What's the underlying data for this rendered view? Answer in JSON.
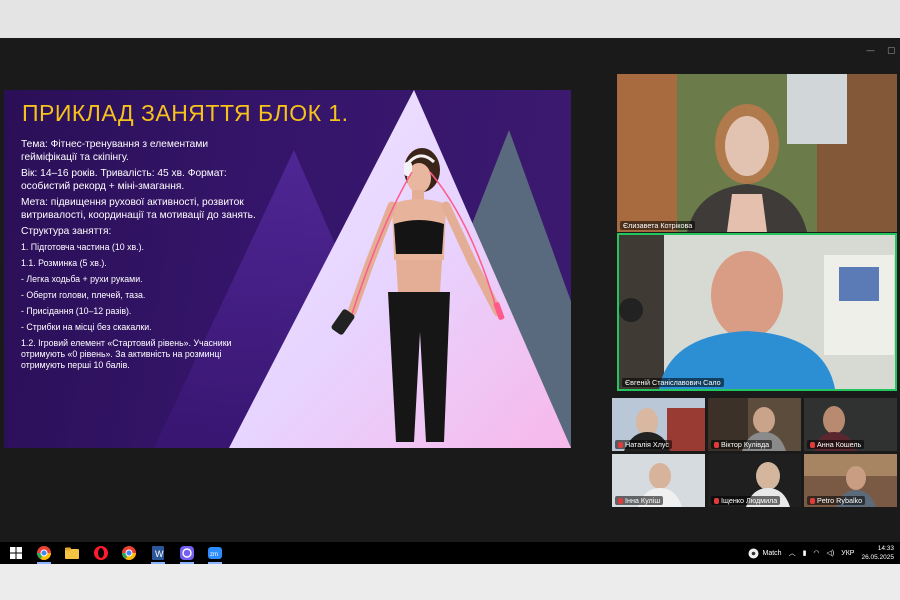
{
  "slide": {
    "title": "ПРИКЛАД ЗАНЯТТЯ БЛОК 1.",
    "paragraphs": [
      "Тема: Фітнес-тренування з елементами гейміфікації та скіпінгу.",
      "Вік: 14–16 років. Тривалість: 45 хв. Формат: особистий рекорд + міні-змагання.",
      "Мета: підвищення рухової активності, розвиток витривалості, координації та мотивації до занять.",
      "Структура заняття:"
    ],
    "items": [
      "1. Підготовча частина (10 хв.).",
      "1.1. Розминка (5 хв.).",
      "- Легка ходьба + рухи руками.",
      "- Оберти голови, плечей, таза.",
      "- Присідання (10–12 разів).",
      "- Стрибки на місці без скакалки.",
      "1.2. Ігровий елемент «Стартовий рівень». Учасники отримують «0 рівень». За активність на розминці отримують перші 10 балів."
    ],
    "colors": {
      "title": "#f6c21c",
      "background": "#2a0f57"
    }
  },
  "participants": {
    "main": [
      {
        "name": "Єлизавета Котрікова"
      },
      {
        "name": "Євгеній Станіславович Сало"
      }
    ],
    "grid": [
      {
        "name": "Наталія Хлус"
      },
      {
        "name": "Віктор Кулівда"
      },
      {
        "name": "Анна Кошель"
      },
      {
        "name": "Інна Куліш"
      },
      {
        "name": "Іщенко Людмила"
      },
      {
        "name": "Petro Rybalko"
      }
    ],
    "active_speaker_color": "#22c55e"
  },
  "taskbar": {
    "apps": [
      "windows-start",
      "chrome",
      "file-explorer",
      "opera",
      "chrome",
      "word",
      "viber",
      "zoom"
    ],
    "weather_label": "Match",
    "language": "УКР",
    "time": "14:33",
    "date": "26.05.2025"
  }
}
